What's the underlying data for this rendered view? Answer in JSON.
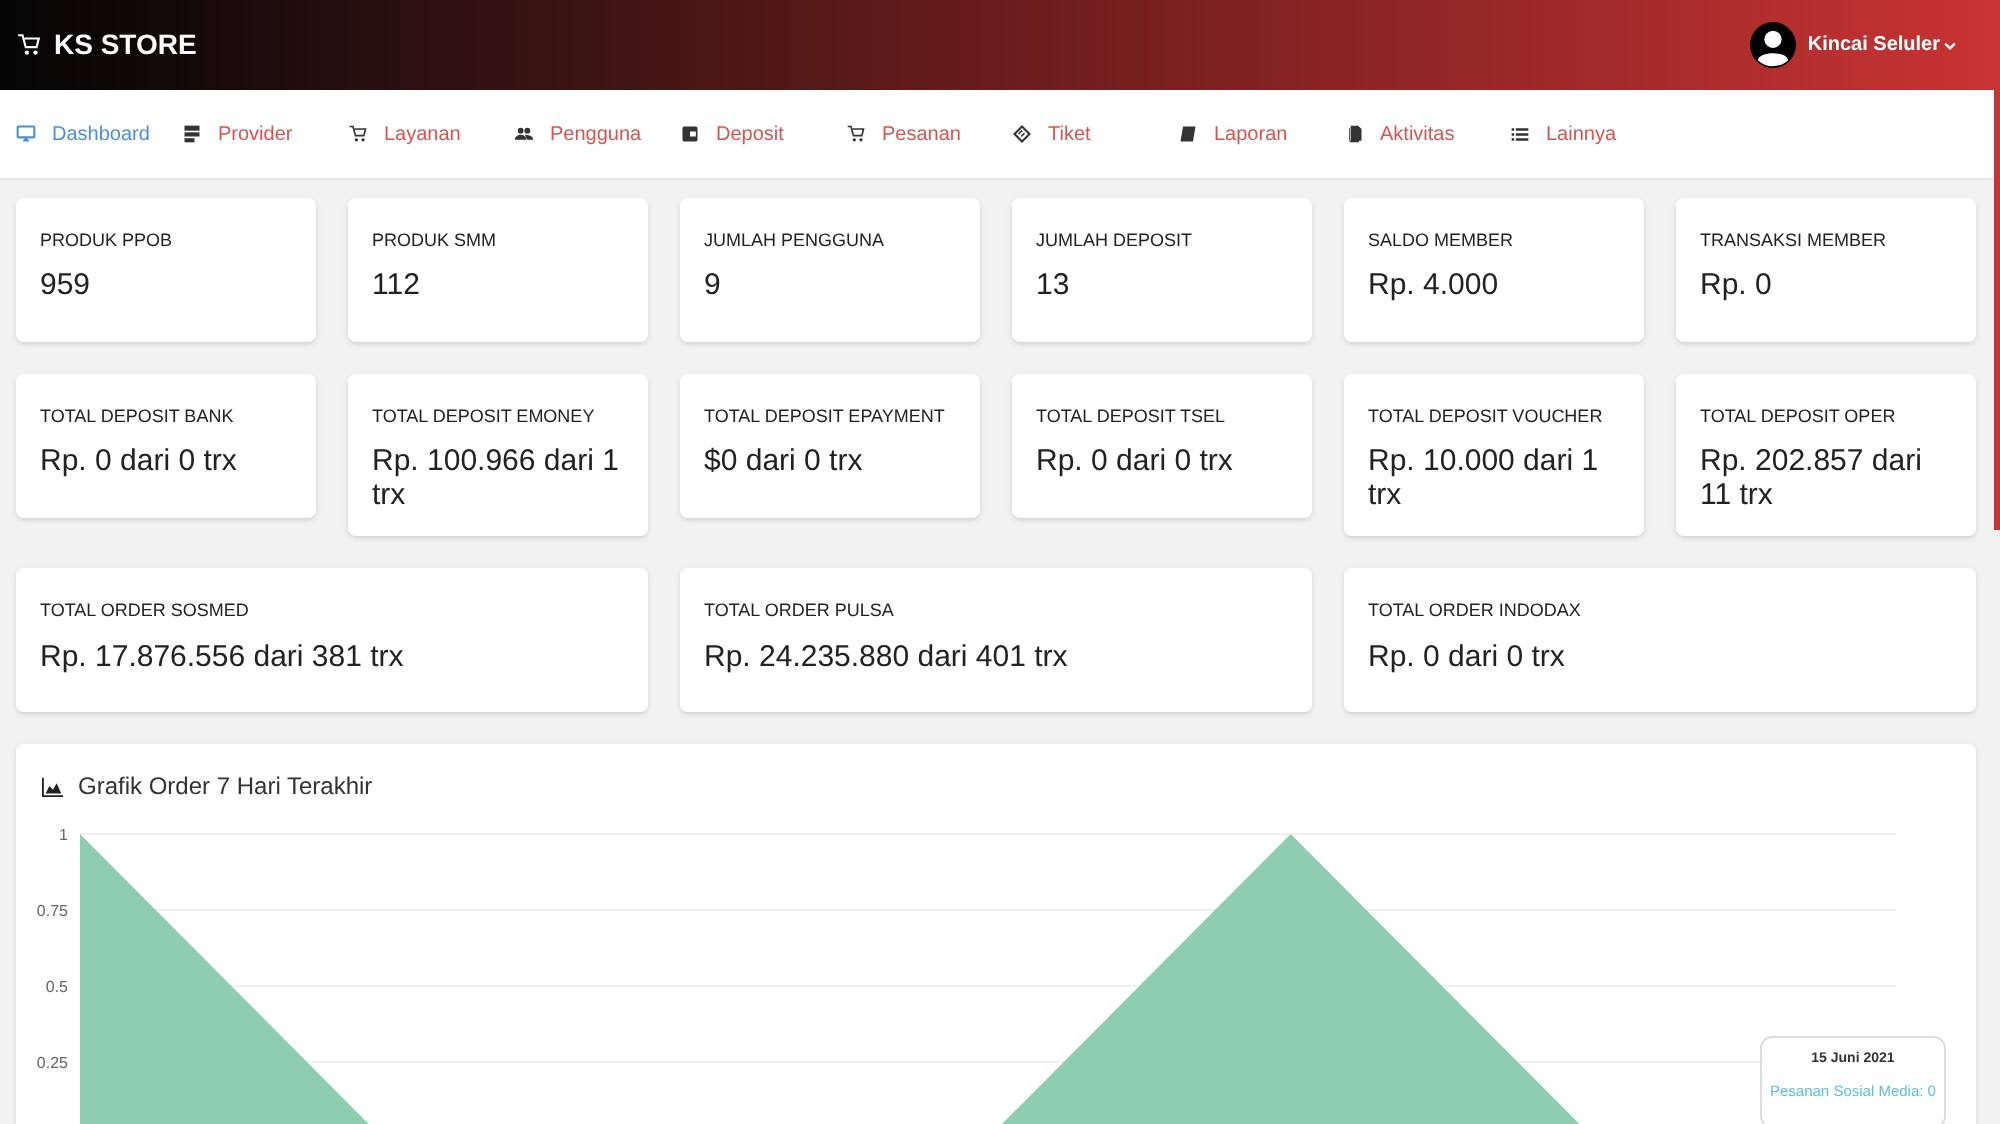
{
  "header": {
    "brand": "KS STORE",
    "user": "Kincai Seluler"
  },
  "nav": [
    {
      "label": "Dashboard",
      "selected": true
    },
    {
      "label": "Provider",
      "selected": false
    },
    {
      "label": "Layanan",
      "selected": false
    },
    {
      "label": "Pengguna",
      "selected": false
    },
    {
      "label": "Deposit",
      "selected": false
    },
    {
      "label": "Pesanan",
      "selected": false
    },
    {
      "label": "Tiket",
      "selected": false
    },
    {
      "label": "Laporan",
      "selected": false
    },
    {
      "label": "Aktivitas",
      "selected": false
    },
    {
      "label": "Lainnya",
      "selected": false
    }
  ],
  "stat_rows": [
    [
      {
        "label": "PRODUK PPOB",
        "value": "959"
      },
      {
        "label": "PRODUK SMM",
        "value": "112"
      },
      {
        "label": "JUMLAH PENGGUNA",
        "value": "9"
      },
      {
        "label": "JUMLAH DEPOSIT",
        "value": "13"
      },
      {
        "label": "SALDO MEMBER",
        "value": "Rp. 4.000"
      },
      {
        "label": "TRANSAKSI MEMBER",
        "value": "Rp. 0"
      }
    ],
    [
      {
        "label": "TOTAL DEPOSIT BANK",
        "value": "Rp. 0 dari 0 trx"
      },
      {
        "label": "TOTAL DEPOSIT EMONEY",
        "value": "Rp. 100.966 dari 1 trx"
      },
      {
        "label": "TOTAL DEPOSIT EPAYMENT",
        "value": "$0 dari 0 trx"
      },
      {
        "label": "TOTAL DEPOSIT TSEL",
        "value": "Rp. 0 dari 0 trx"
      },
      {
        "label": "TOTAL DEPOSIT VOUCHER",
        "value": "Rp. 10.000 dari 1 trx"
      },
      {
        "label": "TOTAL DEPOSIT OPER",
        "value": "Rp. 202.857 dari 11 trx"
      }
    ],
    [
      {
        "label": "TOTAL ORDER SOSMED",
        "value": "Rp. 17.876.556 dari 381 trx"
      },
      {
        "label": "TOTAL ORDER PULSA",
        "value": "Rp. 24.235.880 dari 401 trx"
      },
      {
        "label": "TOTAL ORDER INDODAX",
        "value": "Rp. 0 dari 0 trx"
      }
    ]
  ],
  "chart_panel": {
    "title": "Grafik Order 7 Hari Terakhir",
    "chart_data": {
      "type": "area",
      "grid": true,
      "ylim": [
        0,
        1
      ],
      "yticks": [
        {
          "value": 1,
          "label": "1"
        },
        {
          "value": 0.75,
          "label": "0.75"
        },
        {
          "value": 0.5,
          "label": "0.5"
        },
        {
          "value": 0.25,
          "label": "0.25"
        }
      ],
      "series": [
        {
          "color": "#8fcdb0",
          "values": [
            1,
            0,
            0,
            0,
            1,
            0,
            0
          ]
        }
      ]
    },
    "tooltip": {
      "title": "15 Juni 2021",
      "lines": [
        {
          "text": "Pesanan Sosial Media: 0",
          "color": "#5bc0de"
        }
      ]
    }
  }
}
